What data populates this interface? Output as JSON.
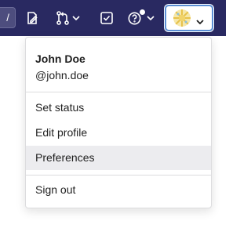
{
  "navbar": {
    "search_shortcut": "/",
    "icons": [
      "edit-icon",
      "merge-request-icon",
      "chevron-down-icon",
      "todo-checkbox-icon",
      "help-icon",
      "chevron-down-icon"
    ],
    "background_color": "#292961"
  },
  "user_menu": {
    "name": "John Doe",
    "username": "@john.doe",
    "items": [
      {
        "label": "Set status"
      },
      {
        "label": "Edit profile"
      },
      {
        "label": "Preferences"
      },
      {
        "label": "Sign out"
      }
    ],
    "hovered_item": "Preferences",
    "hover_color": "#ececef"
  }
}
